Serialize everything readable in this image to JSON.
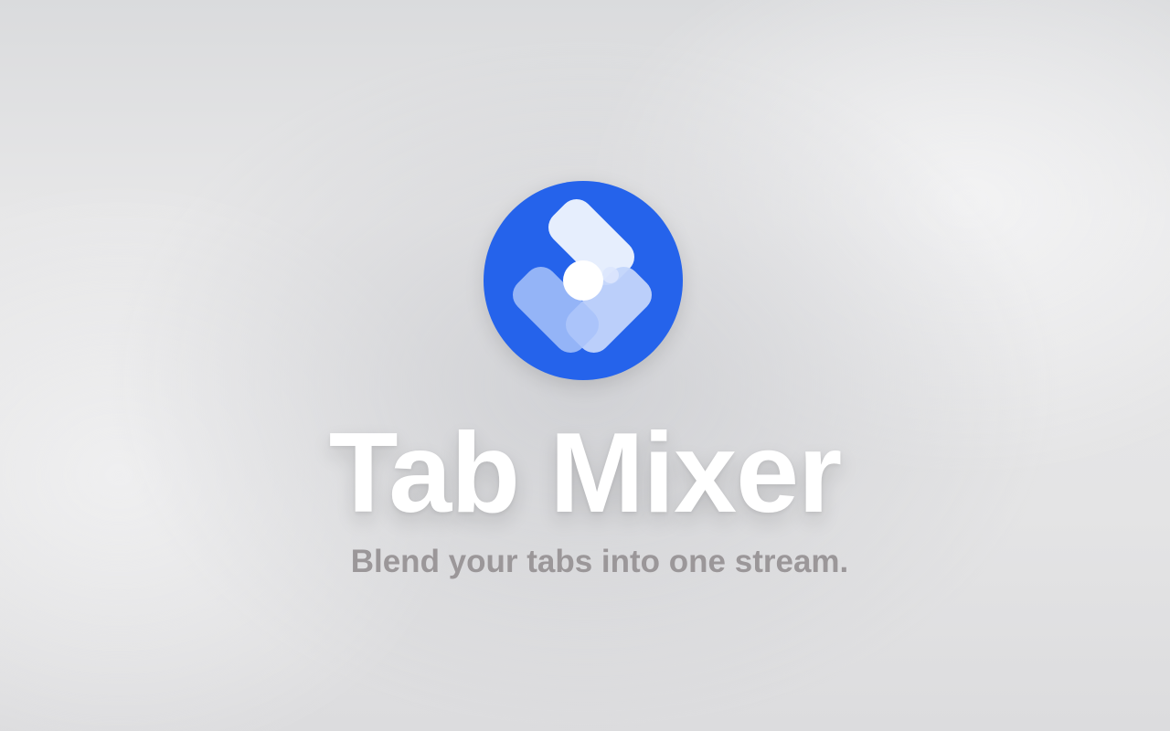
{
  "app": {
    "title": "Tab Mixer",
    "tagline": "Blend your tabs into one stream.",
    "logo_icon": "tab-mixer-logo-icon"
  },
  "colors": {
    "brand_blue": "#2563eb",
    "title_text": "#ffffff",
    "tagline_text": "#9b9799"
  }
}
